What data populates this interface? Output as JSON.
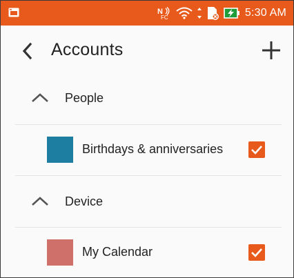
{
  "status_bar": {
    "time": "5:30 AM",
    "icons": [
      "notification-icon",
      "nfc-icon",
      "wifi-icon",
      "data-arrows-icon",
      "sim-icon",
      "battery-charging-icon"
    ],
    "background": "#e85a1b"
  },
  "app_bar": {
    "title": "Accounts",
    "back_icon": "chevron-left-icon",
    "add_icon": "plus-icon"
  },
  "sections": [
    {
      "label": "People",
      "expanded": true,
      "accounts": [
        {
          "label": "Birthdays & anniversaries",
          "color": "#1e7ea1",
          "checked": true
        }
      ]
    },
    {
      "label": "Device",
      "expanded": true,
      "accounts": [
        {
          "label": "My Calendar",
          "color": "#d0706b",
          "checked": true
        }
      ]
    }
  ],
  "accent_color": "#e85a1b"
}
